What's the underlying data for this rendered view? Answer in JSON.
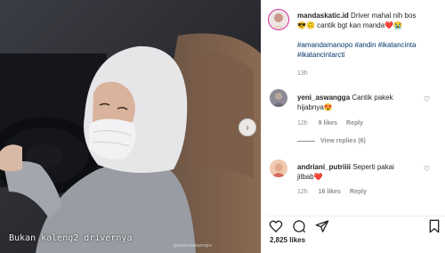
{
  "media": {
    "overlay_caption": "Bukan kaleng2 drivernya",
    "watermark": "@amandamanopo"
  },
  "post": {
    "username": "mandaskatic.id",
    "caption_line1": "Driver mahal nih bos",
    "caption_line2": "😎🙃 cantik bgt kan manda❤️😭",
    "hashtags_line1": "#amandamanopo #andin #ikatancinta",
    "hashtags_line2": "#ikatancintarcti",
    "time": "13h"
  },
  "comments": [
    {
      "username": "yeni_aswangga",
      "text_line1": "Cantik pakek",
      "text_line2": "hijabnya😍",
      "time": "12h",
      "likes": "9 likes",
      "reply": "Reply",
      "view_replies": "View replies (6)"
    },
    {
      "username": "andriani_putriiii",
      "text_line1": "Seperti pakai",
      "text_line2": "jilbab❤️",
      "time": "12h",
      "likes": "16 likes",
      "reply": "Reply"
    }
  ],
  "footer": {
    "likes": "2,825 likes"
  },
  "icons": {
    "like": "heart-icon",
    "comment": "comment-icon",
    "share": "share-icon",
    "save": "bookmark-icon",
    "next": "chevron-right-icon"
  }
}
